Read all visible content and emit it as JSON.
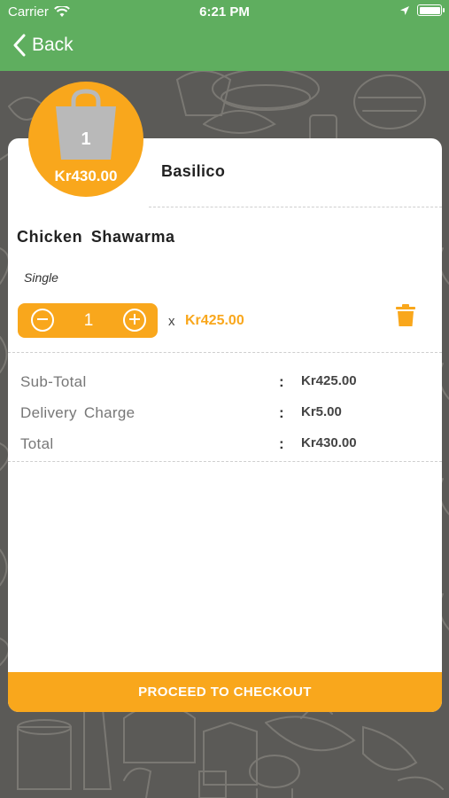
{
  "status_bar": {
    "carrier": "Carrier",
    "time": "6:21 PM"
  },
  "nav": {
    "back_label": "Back"
  },
  "cart_badge": {
    "count": "1",
    "total": "Kr430.00"
  },
  "restaurant": {
    "name": "Basilico"
  },
  "item": {
    "name": "Chicken Shawarma",
    "variant": "Single",
    "quantity": "1",
    "times": "x",
    "unit_price": "Kr425.00"
  },
  "summary": [
    {
      "label": "Sub-Total",
      "colon": ":",
      "value": "Kr425.00"
    },
    {
      "label": "Delivery Charge",
      "colon": ":",
      "value": "Kr5.00"
    },
    {
      "label": "Total",
      "colon": ":",
      "value": "Kr430.00"
    }
  ],
  "checkout_label": "PROCEED TO CHECKOUT",
  "colors": {
    "nav": "#5fae5f",
    "accent": "#f9a71c",
    "background": "#5b5a57"
  },
  "icons": [
    "wifi-icon",
    "location-arrow-icon",
    "battery-icon",
    "chevron-left-icon",
    "shopping-bag-icon",
    "minus-circle-icon",
    "plus-circle-icon",
    "trash-icon"
  ]
}
